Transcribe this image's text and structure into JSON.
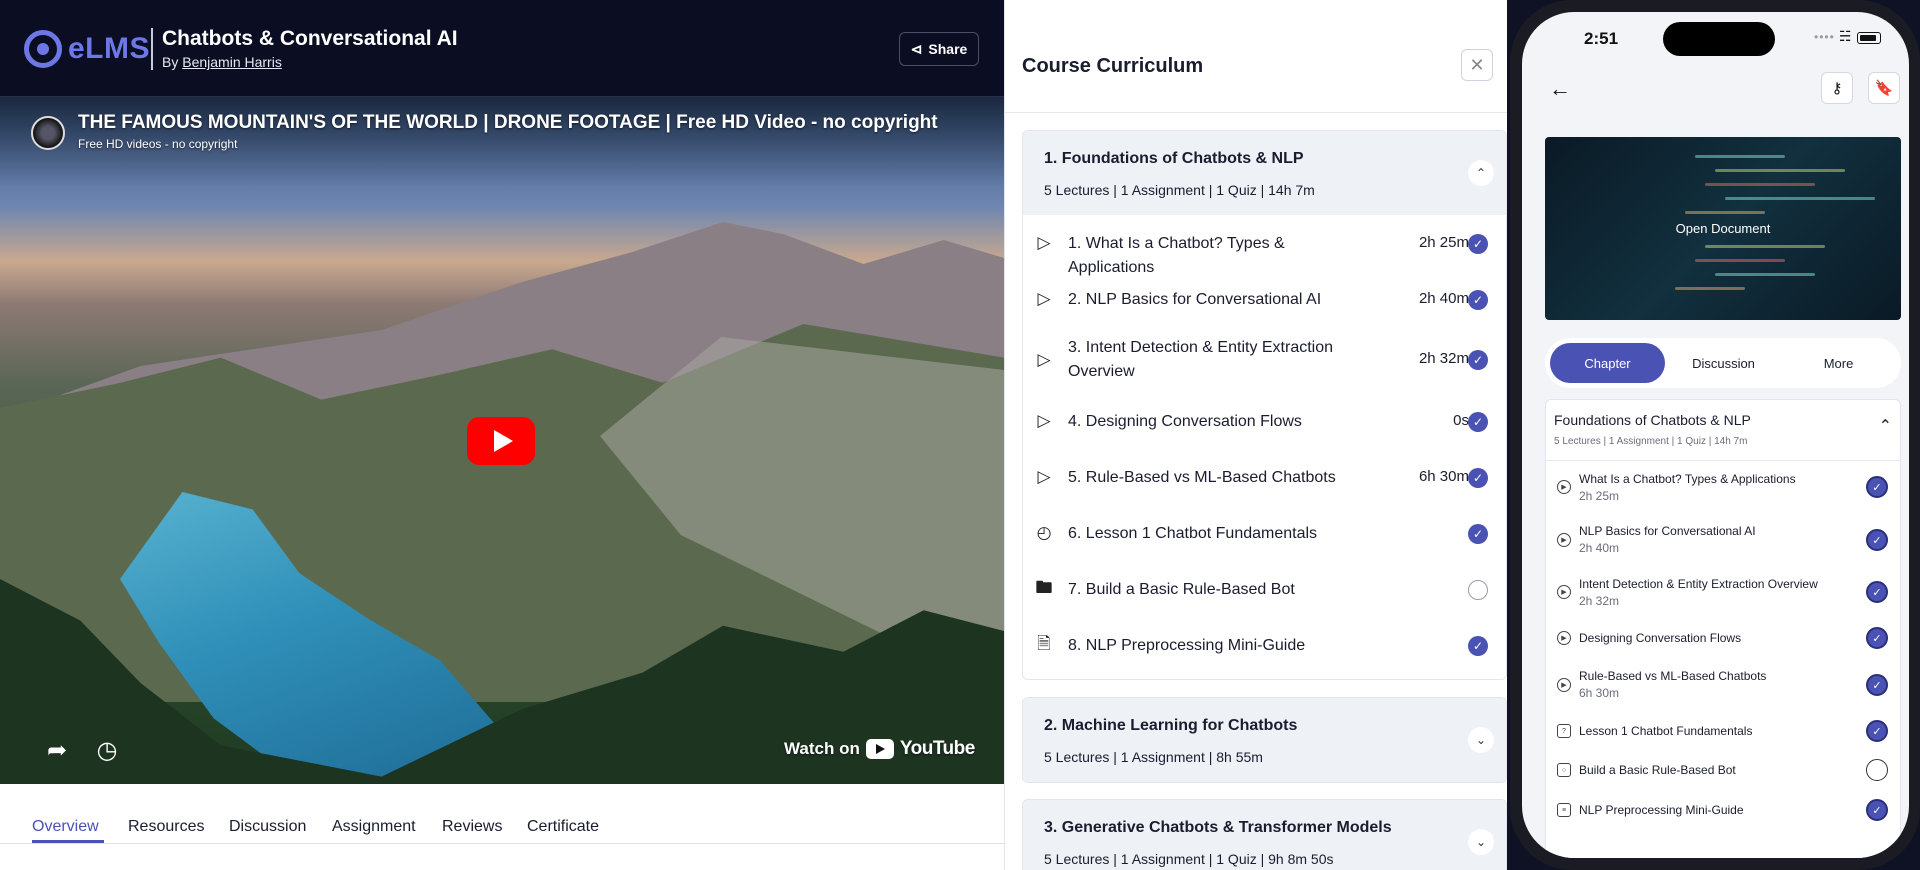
{
  "header": {
    "logo_text": "eLMS",
    "course_title": "Chatbots & Conversational AI",
    "by_prefix": "By",
    "author": "Benjamin Harris",
    "share_label": "Share"
  },
  "video": {
    "title": "THE FAMOUS MOUNTAIN'S OF THE WORLD | DRONE FOOTAGE | Free HD Video - no copyright",
    "channel": "Free HD videos - no copyright",
    "watch_on": "Watch on",
    "youtube": "YouTube"
  },
  "tabs": [
    "Overview",
    "Resources",
    "Discussion",
    "Assignment",
    "Reviews",
    "Certificate"
  ],
  "curriculum": {
    "title": "Course Curriculum",
    "modules": [
      {
        "title": "1. Foundations of Chatbots & NLP",
        "meta": "5 Lectures | 1 Assignment | 1 Quiz | 14h 7m",
        "lectures": [
          {
            "title": "1. What Is a Chatbot? Types & Applications",
            "duration": "2h 25m"
          },
          {
            "title": "2. NLP Basics for Conversational AI",
            "duration": "2h 40m"
          },
          {
            "title": "3. Intent Detection & Entity Extraction Overview",
            "duration": "2h 32m"
          },
          {
            "title": "4. Designing Conversation Flows",
            "duration": "0s"
          },
          {
            "title": "5. Rule-Based vs ML-Based Chatbots",
            "duration": "6h 30m"
          },
          {
            "title": "6. Lesson 1 Chatbot Fundamentals",
            "duration": ""
          },
          {
            "title": "7. Build a Basic Rule-Based Bot",
            "duration": ""
          },
          {
            "title": "8. NLP Preprocessing Mini-Guide",
            "duration": ""
          }
        ]
      },
      {
        "title": "2. Machine Learning for Chatbots",
        "meta": "5 Lectures | 1 Assignment | 8h 55m"
      },
      {
        "title": "3. Generative Chatbots & Transformer Models",
        "meta": "5 Lectures | 1 Assignment | 1 Quiz | 9h 8m 50s"
      }
    ]
  },
  "phone": {
    "time": "2:51",
    "doc_label": "Open Document",
    "segments": [
      "Chapter",
      "Discussion",
      "More"
    ],
    "module_title": "Foundations of Chatbots & NLP",
    "module_meta": "5 Lectures | 1 Assignment | 1 Quiz | 14h 7m",
    "lectures": [
      {
        "title": "What Is a Chatbot? Types & Applications",
        "duration": "2h 25m"
      },
      {
        "title": "NLP Basics for Conversational AI",
        "duration": "2h 40m"
      },
      {
        "title": "Intent Detection & Entity Extraction Overview",
        "duration": "2h 32m"
      },
      {
        "title": "Designing Conversation Flows",
        "duration": ""
      },
      {
        "title": "Rule-Based vs ML-Based Chatbots",
        "duration": "6h 30m"
      },
      {
        "title": "Lesson 1 Chatbot Fundamentals",
        "duration": ""
      },
      {
        "title": "Build a Basic Rule-Based Bot",
        "duration": ""
      },
      {
        "title": "NLP Preprocessing Mini-Guide",
        "duration": ""
      }
    ]
  },
  "colors": {
    "accent": "#4a52b3",
    "logo": "#6d78e6",
    "header_bg": "#0b0e22",
    "youtube_red": "#ff0000"
  }
}
